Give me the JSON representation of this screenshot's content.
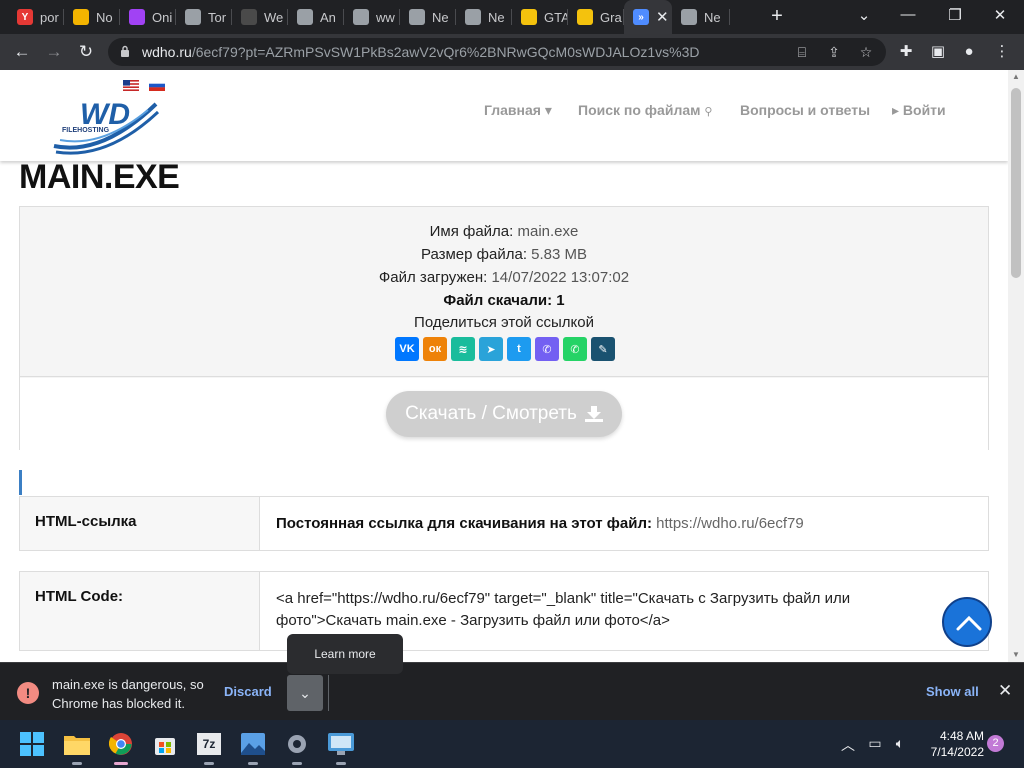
{
  "browser": {
    "tabs": [
      {
        "label": "por",
        "icon": "yandex-icon",
        "color": "#e53935",
        "glyph": "Y"
      },
      {
        "label": "No",
        "icon": "image-flag-icon",
        "color": "#f4b400",
        "glyph": ""
      },
      {
        "label": "Oni",
        "icon": "circle-icon",
        "color": "#a142f4",
        "glyph": ""
      },
      {
        "label": "Tor",
        "icon": "pen-icon",
        "color": "#9aa0a6",
        "glyph": ""
      },
      {
        "label": "We",
        "icon": "crab-icon",
        "color": "#4a4a4a",
        "glyph": ""
      },
      {
        "label": "An",
        "icon": "figure-icon",
        "color": "#9aa0a6",
        "glyph": ""
      },
      {
        "label": "ww",
        "icon": "globe-icon",
        "color": "#9aa0a6",
        "glyph": ""
      },
      {
        "label": "Ne",
        "icon": "chrome-icon",
        "color": "#9aa0a6",
        "glyph": ""
      },
      {
        "label": "Ne",
        "icon": "chrome-icon",
        "color": "#9aa0a6",
        "glyph": ""
      },
      {
        "label": "GTA",
        "icon": "bolt-icon",
        "color": "#f4c20d",
        "glyph": ""
      },
      {
        "label": "Gra",
        "icon": "bolt-icon",
        "color": "#f4c20d",
        "glyph": ""
      },
      {
        "label": "",
        "icon": "double-chevron-icon",
        "color": "#4f8cff",
        "glyph": "»",
        "active": true
      },
      {
        "label": "Ne",
        "icon": "chrome-icon",
        "color": "#9aa0a6",
        "glyph": ""
      }
    ],
    "address": {
      "host": "wdho.ru",
      "path": "/6ecf79?pt=AZRmPSvSW1PkBs2awV2vQr6%2BNRwGQcM0sWDJALOz1vs%3D"
    }
  },
  "site": {
    "logo_text": "WD",
    "logo_sub": "FILEHOSTING",
    "nav": {
      "home": "Главная ▾",
      "search": "Поиск по файлам",
      "faq": "Вопросы и ответы",
      "login": "▸ Войти"
    }
  },
  "file": {
    "title": "MAIN.EXE",
    "name_label": "Имя файла:",
    "name_value": "main.exe",
    "size_label": "Размер файла:",
    "size_value": "5.83 MB",
    "uploaded_label": "Файл загружен:",
    "uploaded_value": "14/07/2022 13:07:02",
    "downloads_text": "Файл скачали: 1",
    "share_label": "Поделиться этой ссылкой",
    "share_buttons": [
      {
        "name": "vk",
        "glyph": "VK",
        "color": "#0077ff"
      },
      {
        "name": "odnoklassniki",
        "glyph": "ок",
        "color": "#ee8208"
      },
      {
        "name": "yandex-messenger",
        "glyph": "≋",
        "color": "#1abc9c"
      },
      {
        "name": "telegram",
        "glyph": "➤",
        "color": "#2aa3d9"
      },
      {
        "name": "twitter",
        "glyph": "t",
        "color": "#1d9bf0"
      },
      {
        "name": "viber",
        "glyph": "✆",
        "color": "#7360f2"
      },
      {
        "name": "whatsapp",
        "glyph": "✆",
        "color": "#25d366"
      },
      {
        "name": "livejournal",
        "glyph": "✎",
        "color": "#1a5270"
      }
    ],
    "download_button": "Скачать / Смотреть"
  },
  "links": {
    "html_link_label": "HTML-ссылка",
    "permalink_label": "Постоянная ссылка для скачивания на этот файл:",
    "permalink_url": "https://wdho.ru/6ecf79",
    "html_code_label": "HTML Code:",
    "html_code_value": "<a href=\"https://wdho.ru/6ecf79\" target=\"_blank\" title=\"Скачать с Загрузить файл или фото\">Скачать main.exe - Загрузить файл или фото</a>"
  },
  "tooltip": "Learn more",
  "download_bar": {
    "message_line1": "main.exe is dangerous, so",
    "message_line2": "Chrome has blocked it.",
    "discard": "Discard",
    "show_all": "Show all"
  },
  "taskbar": {
    "time": "4:48 AM",
    "date": "7/14/2022",
    "notifications": "2",
    "apps": [
      "start-icon",
      "file-explorer-icon",
      "chrome-icon",
      "store-icon",
      "7zip-icon",
      "photos-icon",
      "settings-icon",
      "control-panel-icon"
    ]
  }
}
